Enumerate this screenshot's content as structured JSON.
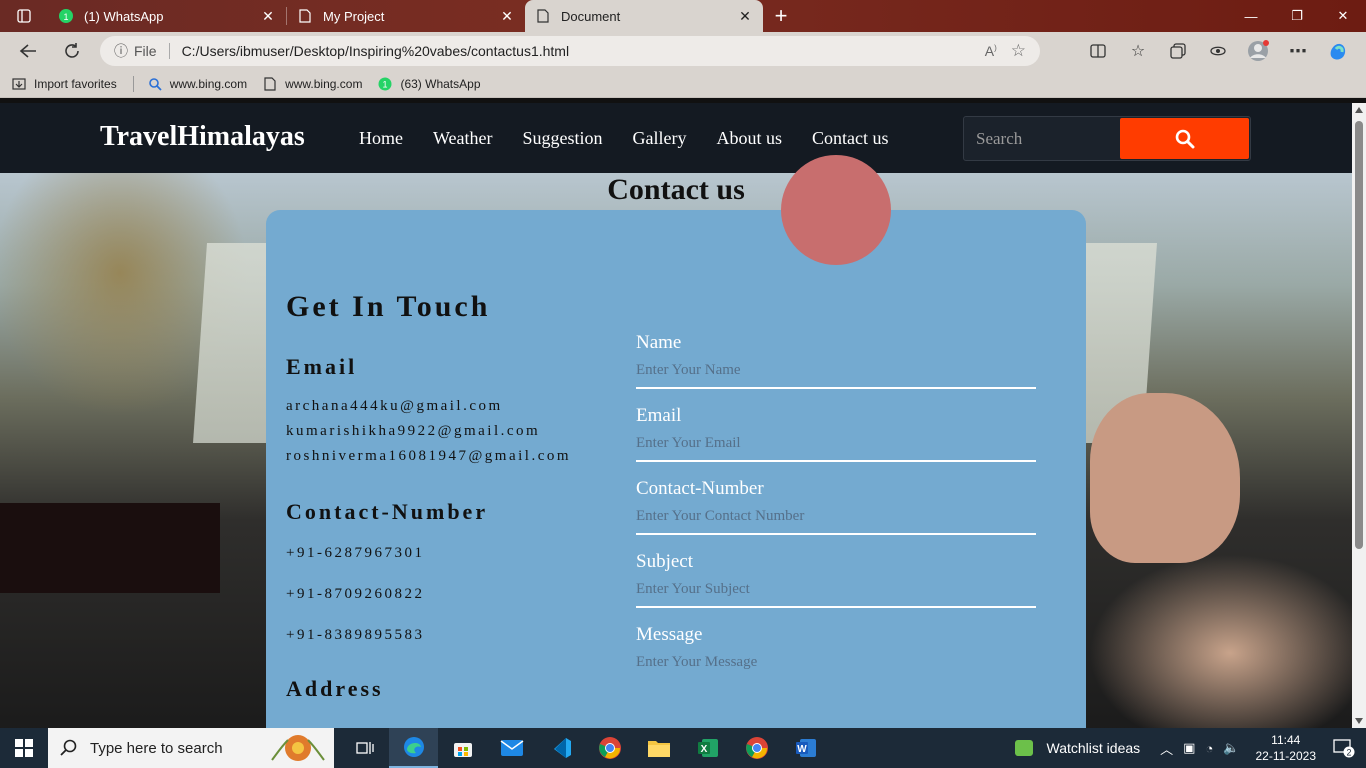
{
  "browser": {
    "tabs": [
      {
        "title": "(1) WhatsApp",
        "icon": "whatsapp-icon",
        "active": false
      },
      {
        "title": "My Project",
        "icon": "page-icon",
        "active": false
      },
      {
        "title": "Document",
        "icon": "page-icon",
        "active": true
      }
    ],
    "address": {
      "scheme_label": "File",
      "url": "C:/Users/ibmuser/Desktop/Inspiring%20vabes/contactus1.html"
    },
    "favorites": [
      {
        "label": "Import favorites",
        "icon": "import-icon"
      },
      {
        "label": "www.bing.com",
        "icon": "bing-search-icon"
      },
      {
        "label": "www.bing.com",
        "icon": "page-icon"
      },
      {
        "label": "(63) WhatsApp",
        "icon": "whatsapp-icon"
      }
    ],
    "favorites_whatsapp_badge": "1"
  },
  "site": {
    "brand": "TravelHimalayas",
    "nav": [
      "Home",
      "Weather",
      "Suggestion",
      "Gallery",
      "About us",
      "Contact us"
    ],
    "search_placeholder": "Search",
    "page_heading": "Contact us",
    "accent_color": "#ff3c00",
    "card_color": "#74aad0",
    "blob_color": "#c86e6e"
  },
  "info": {
    "title": "Get In Touch",
    "email_heading": "Email",
    "emails": [
      "archana444ku@gmail.com",
      "kumarishikha9922@gmail.com",
      "roshniverma16081947@gmail.com"
    ],
    "contact_heading": "Contact-Number",
    "phones": [
      "+91-6287967301",
      "+91-8709260822",
      "+91-8389895583"
    ],
    "address_heading": "Address"
  },
  "form": {
    "fields": [
      {
        "label": "Name",
        "placeholder": "Enter Your Name"
      },
      {
        "label": "Email",
        "placeholder": "Enter Your Email"
      },
      {
        "label": "Contact-Number",
        "placeholder": "Enter Your Contact Number"
      },
      {
        "label": "Subject",
        "placeholder": "Enter Your Subject"
      },
      {
        "label": "Message",
        "placeholder": "Enter Your Message"
      }
    ]
  },
  "taskbar": {
    "search_placeholder": "Type here to search",
    "widget_label": "Watchlist ideas",
    "time": "11:44",
    "date": "22-11-2023",
    "notification_count": "2"
  }
}
